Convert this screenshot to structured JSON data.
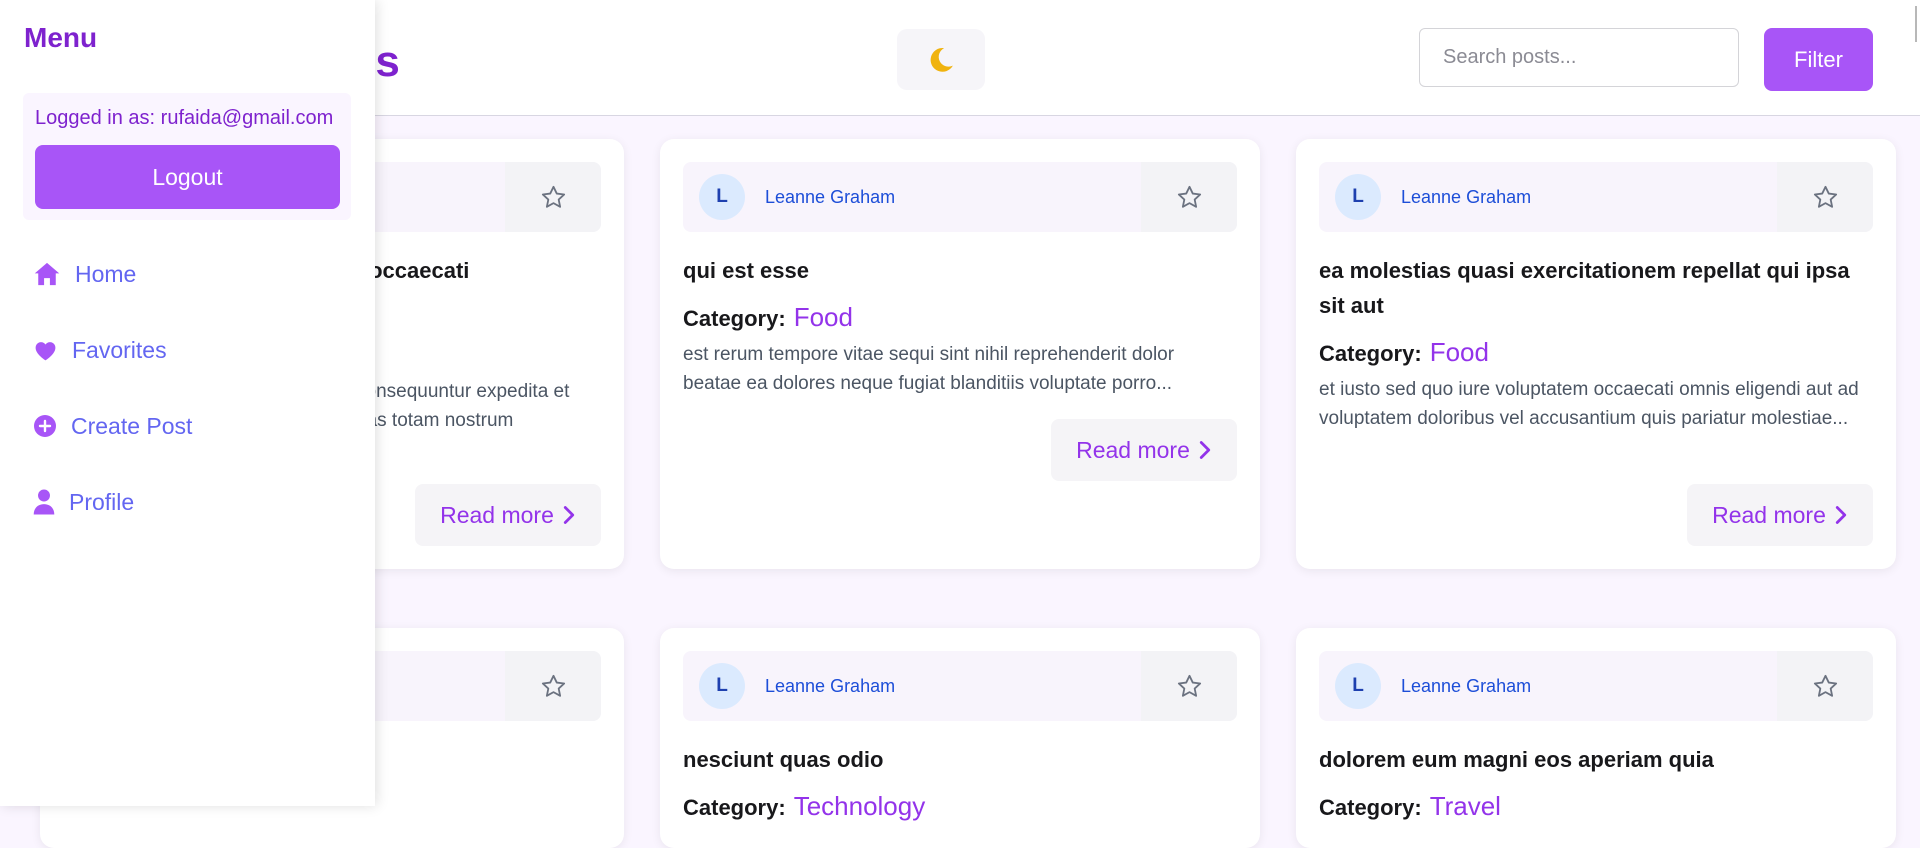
{
  "header": {
    "title": "Posts",
    "search_placeholder": "Search posts...",
    "filter_label": "Filter",
    "theme_icon": "moon-icon",
    "theme_icon_color": "#f0b30f"
  },
  "colors": {
    "accent": "#a855f7",
    "title": "#7e22ce",
    "author": "#1d4ed8",
    "category": "#9333ea",
    "nav": "#6366f1"
  },
  "sidebar": {
    "title": "Menu",
    "logged_in_text": "Logged in as: rufaida@gmail.com",
    "logout_label": "Logout",
    "items": [
      {
        "label": "Home",
        "icon": "home-icon"
      },
      {
        "label": "Favorites",
        "icon": "heart-icon"
      },
      {
        "label": "Create Post",
        "icon": "plus-circle-icon"
      },
      {
        "label": "Profile",
        "icon": "user-icon"
      }
    ]
  },
  "category_label": "Category:",
  "read_more_label": "Read more",
  "posts": [
    {
      "author_initial": "",
      "author": "",
      "title": "ent occaecati",
      "category": "",
      "excerpt": "consequuntur expedita et uas totam nostrum"
    },
    {
      "author_initial": "L",
      "author": "Leanne Graham",
      "title": "qui est esse",
      "category": "Food",
      "excerpt": "est rerum tempore vitae sequi sint nihil reprehenderit dolor beatae ea dolores neque fugiat blanditiis voluptate porro..."
    },
    {
      "author_initial": "L",
      "author": "Leanne Graham",
      "title": "ea molestias quasi exercitationem repellat qui ipsa sit aut",
      "category": "Food",
      "excerpt": "et iusto sed quo iure voluptatem occaecati omnis eligendi aut ad voluptatem doloribus vel accusantium quis pariatur molestiae..."
    },
    {
      "author_initial": "",
      "author": "",
      "title": "",
      "category": "",
      "excerpt": ""
    },
    {
      "author_initial": "L",
      "author": "Leanne Graham",
      "title": "nesciunt quas odio",
      "category": "Technology",
      "excerpt": ""
    },
    {
      "author_initial": "L",
      "author": "Leanne Graham",
      "title": "dolorem eum magni eos aperiam quia",
      "category": "Travel",
      "excerpt": ""
    }
  ]
}
